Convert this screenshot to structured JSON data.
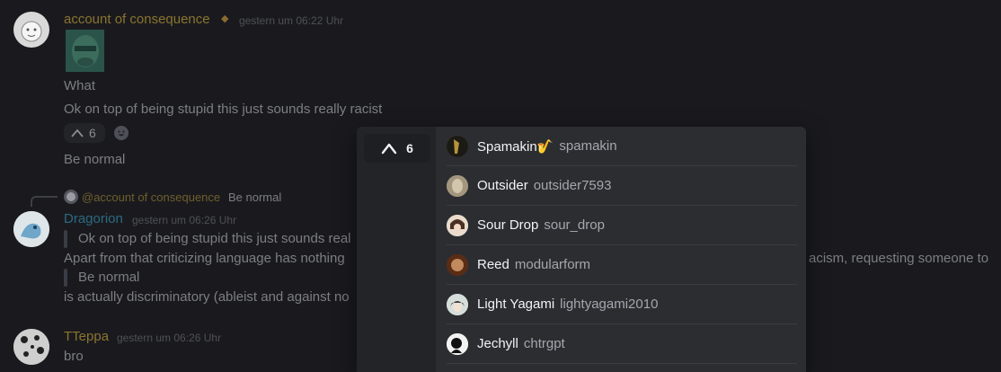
{
  "messages": [
    {
      "username": "account of consequence",
      "username_color": "#8a7430",
      "badge": "◆",
      "timestamp": "gestern um 06:22 Uhr",
      "lines": [
        "What",
        "Ok on top of being stupid this just sounds really racist"
      ],
      "reaction_count": "6",
      "followup": "Be normal"
    },
    {
      "reply_to_user": "@account of consequence",
      "reply_to_text": "Be normal",
      "username": "Dragorion",
      "username_color": "#2c6a82",
      "timestamp": "gestern um 06:26 Uhr",
      "quote1": "Ok on top of being stupid this just sounds real",
      "line1": "Apart from that criticizing language has nothing",
      "line1_tail": "acism, requesting someone to",
      "quote2": "Be normal",
      "line2": "is actually discriminatory (ableist and against no"
    },
    {
      "username": "TTeppa",
      "username_color": "#8a7430",
      "timestamp": "gestern um 06:26 Uhr",
      "line": "bro"
    }
  ],
  "reaction_popup": {
    "count": "6",
    "users": [
      {
        "display": "Spamakin🎷",
        "handle": "spamakin",
        "avatar_color": "#6b5a30"
      },
      {
        "display": "Outsider",
        "handle": "outsider7593",
        "avatar_color": "#8f7f66"
      },
      {
        "display": "Sour Drop",
        "handle": "sour_drop",
        "avatar_color": "#d8c8b6"
      },
      {
        "display": "Reed",
        "handle": "modularform",
        "avatar_color": "#6e3a1e"
      },
      {
        "display": "Light Yagami",
        "handle": "lightyagami2010",
        "avatar_color": "#c9d1cf"
      },
      {
        "display": "Jechyll",
        "handle": "chtrgpt",
        "avatar_color": "#e8e8e8"
      }
    ]
  }
}
